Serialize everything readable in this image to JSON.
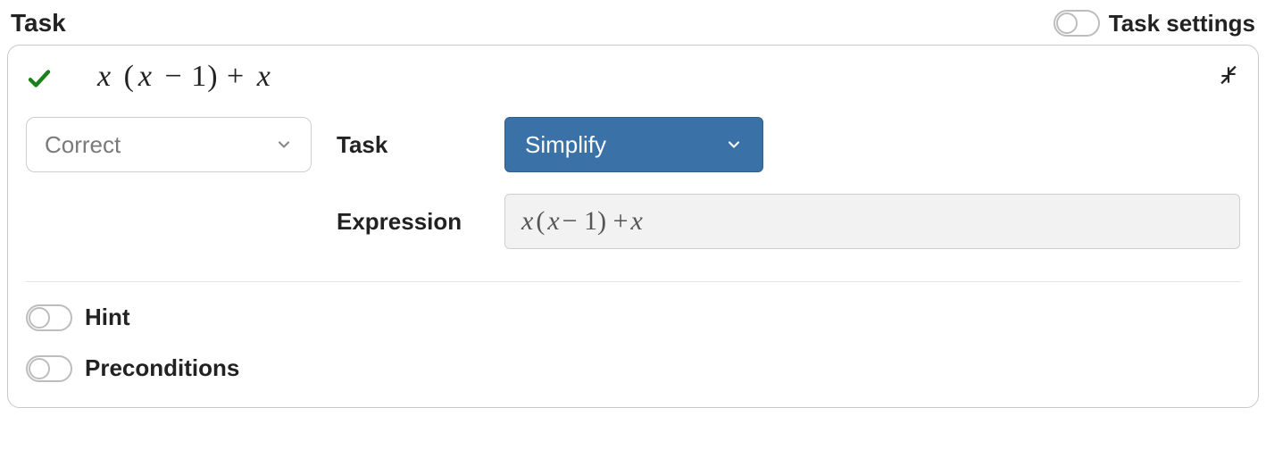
{
  "header": {
    "title": "Task",
    "settings_label": "Task settings",
    "settings_on": false
  },
  "task": {
    "header_expression": "x (x − 1) + x",
    "status_select": {
      "value": "Correct"
    },
    "fields": {
      "task_label": "Task",
      "task_select_value": "Simplify",
      "expression_label": "Expression",
      "expression_value": "x(x − 1) + x"
    },
    "toggles": {
      "hint": {
        "label": "Hint",
        "on": false
      },
      "preconditions": {
        "label": "Preconditions",
        "on": false
      }
    }
  }
}
